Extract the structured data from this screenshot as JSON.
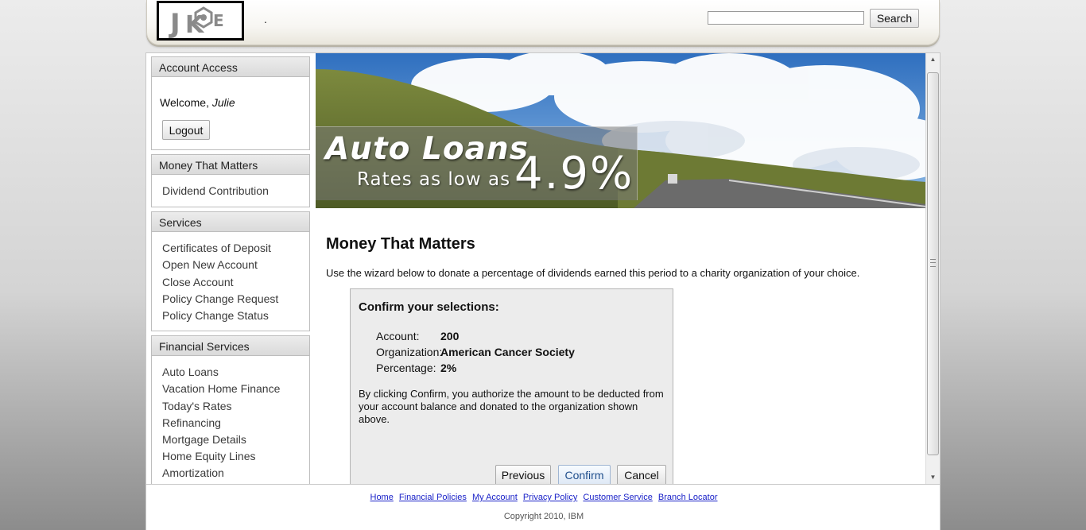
{
  "header": {
    "logo_text": "JKE",
    "separator": ".",
    "search_placeholder": "",
    "search_button": "Search"
  },
  "sidebar": {
    "account_access": {
      "title": "Account Access",
      "welcome": "Welcome,",
      "user": "Julie",
      "logout": "Logout"
    },
    "money_that_matters": {
      "title": "Money That Matters",
      "items": [
        "Dividend Contribution"
      ]
    },
    "services": {
      "title": "Services",
      "items": [
        "Certificates of Deposit",
        "Open New Account",
        "Close Account",
        "Policy Change Request",
        "Policy Change Status"
      ]
    },
    "financial_services": {
      "title": "Financial Services",
      "items": [
        "Auto Loans",
        "Vacation Home Finance",
        "Today's Rates",
        "Refinancing",
        "Mortgage Details",
        "Home Equity Lines",
        "Amortization"
      ]
    }
  },
  "banner": {
    "title": "Auto Loans",
    "subtitle": "Rates as low as",
    "rate": "4.9%"
  },
  "main": {
    "title": "Money That Matters",
    "intro": "Use the wizard below to donate a percentage of dividends earned this period to a charity organization of your choice.",
    "wizard": {
      "heading": "Confirm your selections:",
      "rows": [
        {
          "label": "Account:",
          "value": "200"
        },
        {
          "label": "Organization:",
          "value": "American Cancer Society"
        },
        {
          "label": "Percentage:",
          "value": "2%"
        }
      ],
      "disclaimer": "By clicking Confirm, you authorize the amount to be deducted from your account balance and donated to the organization shown above.",
      "buttons": {
        "previous": "Previous",
        "confirm": "Confirm",
        "cancel": "Cancel"
      }
    }
  },
  "footer": {
    "links": [
      "Home",
      "Financial Policies",
      "My Account",
      "Privacy Policy",
      "Customer Service",
      "Branch Locator"
    ],
    "copyright": "Copyright 2010, IBM"
  },
  "colors": {
    "link": "#1a22c8",
    "panel_header": "#dadada",
    "wizard_bg": "#ececec"
  }
}
